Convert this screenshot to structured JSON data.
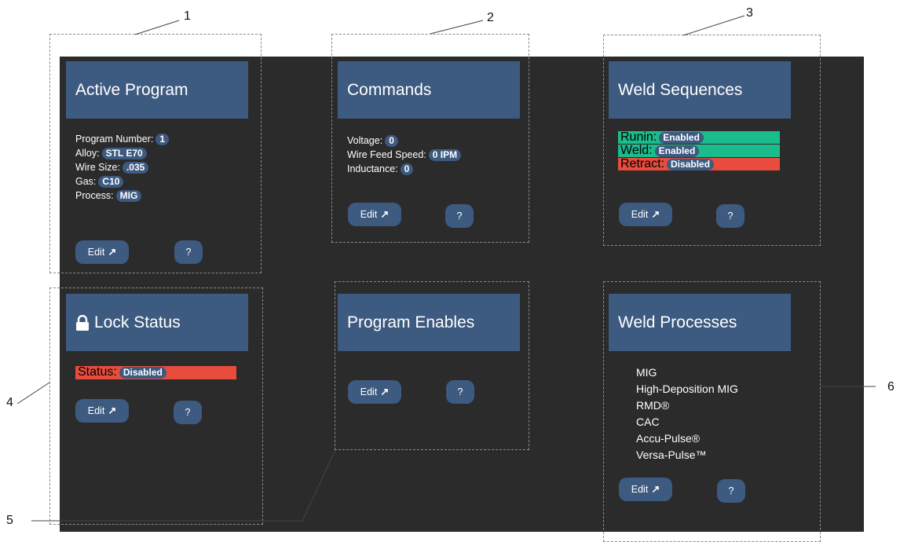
{
  "callouts": [
    "1",
    "2",
    "3",
    "4",
    "5",
    "6"
  ],
  "active_program": {
    "title": "Active Program",
    "rows": [
      {
        "label": "Program Number:",
        "value": "1"
      },
      {
        "label": "Alloy:",
        "value": "STL E70"
      },
      {
        "label": "Wire Size:",
        "value": ".035"
      },
      {
        "label": "Gas:",
        "value": "C10"
      },
      {
        "label": "Process:",
        "value": "MIG"
      }
    ],
    "edit_label": "Edit",
    "help_label": "?"
  },
  "commands": {
    "title": "Commands",
    "rows": [
      {
        "label": "Voltage:",
        "value": "0"
      },
      {
        "label": "Wire Feed Speed:",
        "value": "0 IPM"
      },
      {
        "label": "Inductance:",
        "value": "0"
      }
    ],
    "edit_label": "Edit",
    "help_label": "?"
  },
  "weld_sequences": {
    "title": "Weld Sequences",
    "rows": [
      {
        "label": "Runin:",
        "value": "Enabled"
      },
      {
        "label": "Weld:",
        "value": "Enabled"
      },
      {
        "label": "Retract:",
        "value": "Disabled"
      }
    ],
    "edit_label": "Edit",
    "help_label": "?"
  },
  "lock_status": {
    "title": "Lock Status",
    "status_label": "Status:",
    "status_value": "Disabled",
    "edit_label": "Edit",
    "help_label": "?"
  },
  "program_enables": {
    "title": "Program Enables",
    "edit_label": "Edit",
    "help_label": "?"
  },
  "weld_processes": {
    "title": "Weld Processes",
    "items": [
      "MIG",
      "High-Deposition MIG",
      "RMD®",
      "CAC",
      "Accu-Pulse®",
      "Versa-Pulse™"
    ],
    "edit_label": "Edit",
    "help_label": "?"
  },
  "colors": {
    "panel_bg": "#2b2b2b",
    "card_blue": "#3d5a80",
    "enabled_green": "#1abc8c",
    "disabled_red": "#e74c3c"
  }
}
